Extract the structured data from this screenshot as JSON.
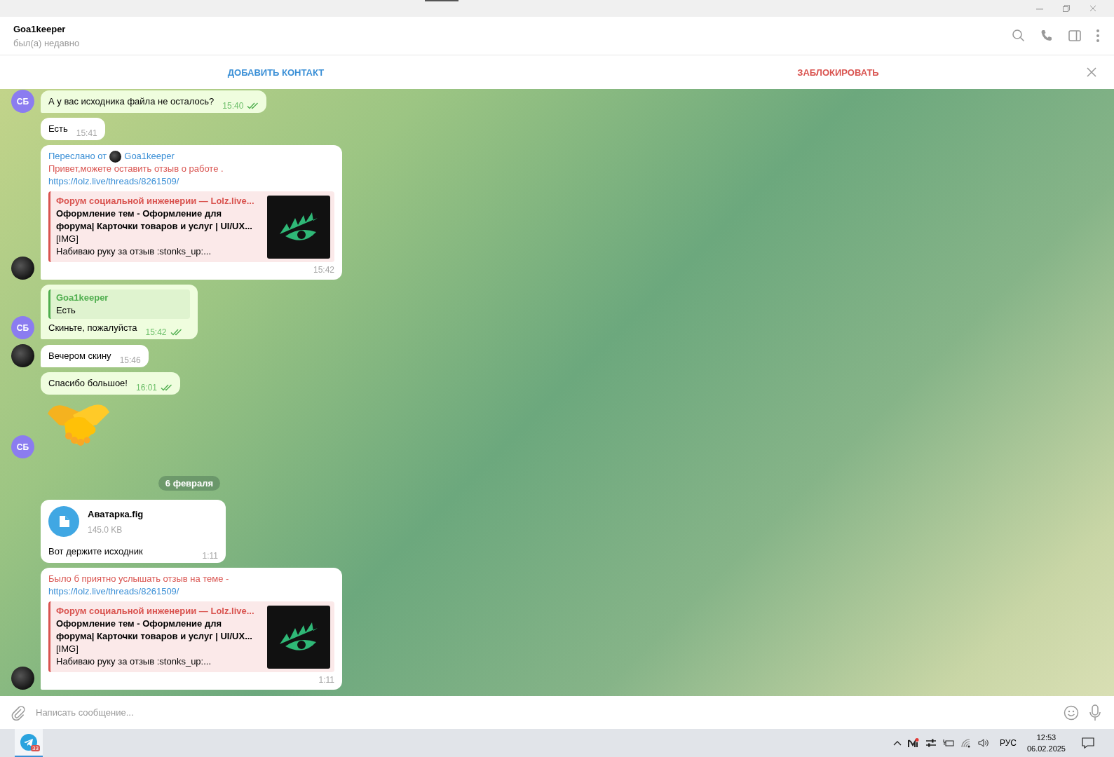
{
  "chat_header": {
    "name": "Goa1keeper",
    "status": "был(а) недавно"
  },
  "action_bar": {
    "add_contact": "ДОБАВИТЬ КОНТАКТ",
    "block": "ЗАБЛОКИРОВАТЬ"
  },
  "messages": [
    {
      "kind": "text",
      "outgoing": true,
      "show_avatar": true,
      "avatar_text": "СБ",
      "text": "А у вас исходника файла не осталось?",
      "time": "15:40"
    },
    {
      "kind": "text",
      "outgoing": false,
      "show_avatar": false,
      "text": "Есть",
      "time": "15:41"
    },
    {
      "kind": "forwarded",
      "outgoing": false,
      "show_avatar": true,
      "forwarded_label": "Переслано от",
      "forwarded_from": "Goa1keeper",
      "text": "Привет,можете оставить отзыв о работе .",
      "link": "https://lolz.live/threads/8261509/",
      "preview": {
        "site": "Форум социальной инженерии —  Lolz.live...",
        "title": "Оформление тем - Оформление для форума| Карточки товаров и услуг | UI/UX...",
        "line_1": "[IMG]",
        "line_2": "Набиваю руку за отзыв  :stonks_up:..."
      },
      "time": "15:42"
    },
    {
      "kind": "reply",
      "outgoing": true,
      "show_avatar": true,
      "avatar_text": "СБ",
      "reply_to": {
        "name": "Goa1keeper",
        "text": "Есть"
      },
      "text": "Скиньте, пожалуйста",
      "time": "15:42"
    },
    {
      "kind": "text",
      "outgoing": false,
      "show_avatar": true,
      "text": "Вечером скину",
      "time": "15:46"
    },
    {
      "kind": "text",
      "outgoing": true,
      "show_avatar": false,
      "text": "Спасибо большое!",
      "time": "16:01"
    },
    {
      "kind": "sticker",
      "outgoing": true,
      "show_avatar": true,
      "avatar_text": "СБ"
    },
    {
      "kind": "date",
      "text": "6 февраля"
    },
    {
      "kind": "file",
      "outgoing": false,
      "show_avatar": false,
      "file_name": "Аватарка.fig",
      "size": "145.0 KB",
      "text": "Вот держите исходник",
      "time": "1:11"
    },
    {
      "kind": "link",
      "outgoing": false,
      "show_avatar": true,
      "text": "Было б приятно услышать отзыв на теме -",
      "link": "https://lolz.live/threads/8261509/",
      "preview": {
        "site": "Форум социальной инженерии —  Lolz.live...",
        "title": "Оформление тем - Оформление для форума| Карточки товаров и услуг | UI/UX...",
        "line_1": "[IMG]",
        "line_2": "Набиваю руку за отзыв  :stonks_up:..."
      },
      "time": "1:11"
    }
  ],
  "composer": {
    "placeholder": "Написать сообщение..."
  },
  "taskbar": {
    "app_badge": "33",
    "language": "РУС",
    "time": "12:53",
    "date": "06.02.2025"
  }
}
